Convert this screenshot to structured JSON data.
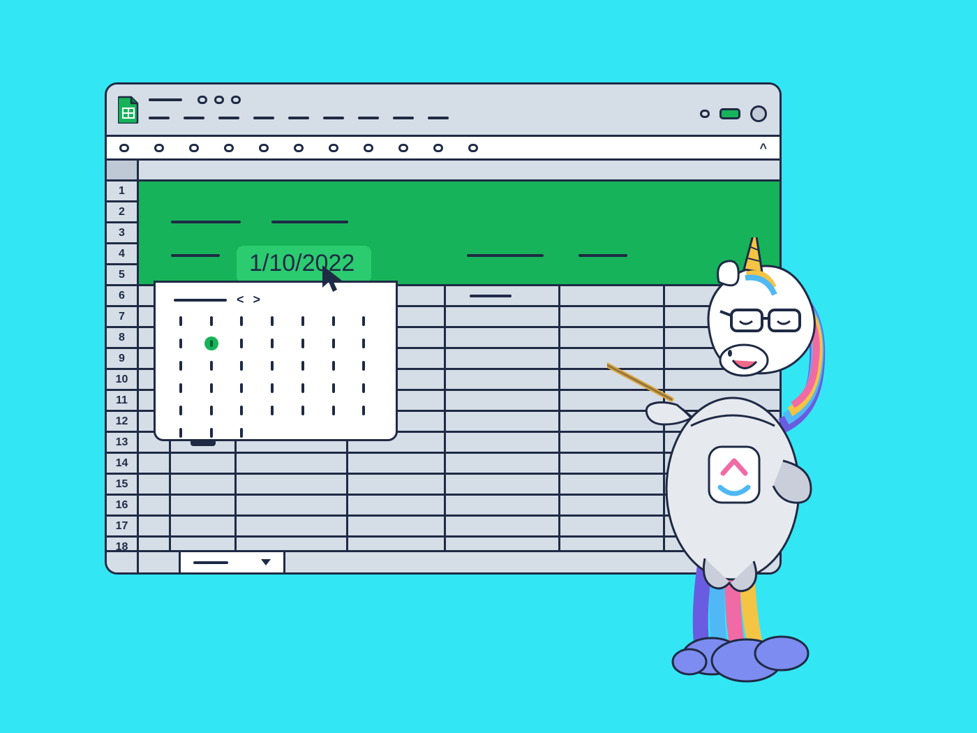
{
  "app": {
    "name": "Google Sheets",
    "icon": "sheets-icon"
  },
  "window": {
    "controls": [
      "minimize",
      "share-green",
      "avatar"
    ]
  },
  "toolbar": {
    "items_count": 11,
    "expand_icon": "^"
  },
  "sheet": {
    "row_numbers": [
      1,
      2,
      3,
      4,
      5,
      6,
      7,
      8,
      9,
      10,
      11,
      12,
      13,
      14,
      15,
      16,
      17,
      18
    ],
    "column_count": 6,
    "header_band_color": "#17B35A",
    "date_input": {
      "value": "1/10/2022"
    }
  },
  "datepicker": {
    "nav_prev": "<",
    "nav_next": ">",
    "rows": 6,
    "cols": 7,
    "selected_row": 1,
    "selected_col": 1
  },
  "tabbar": {
    "active_tab_dropdown": "▾"
  },
  "mascot": {
    "name": "unicorn-presenter",
    "badge": "clickup-logo"
  },
  "colors": {
    "background": "#33E6F4",
    "ink": "#1F2A44",
    "green": "#17B35A",
    "panel": "#D5DDE7"
  }
}
